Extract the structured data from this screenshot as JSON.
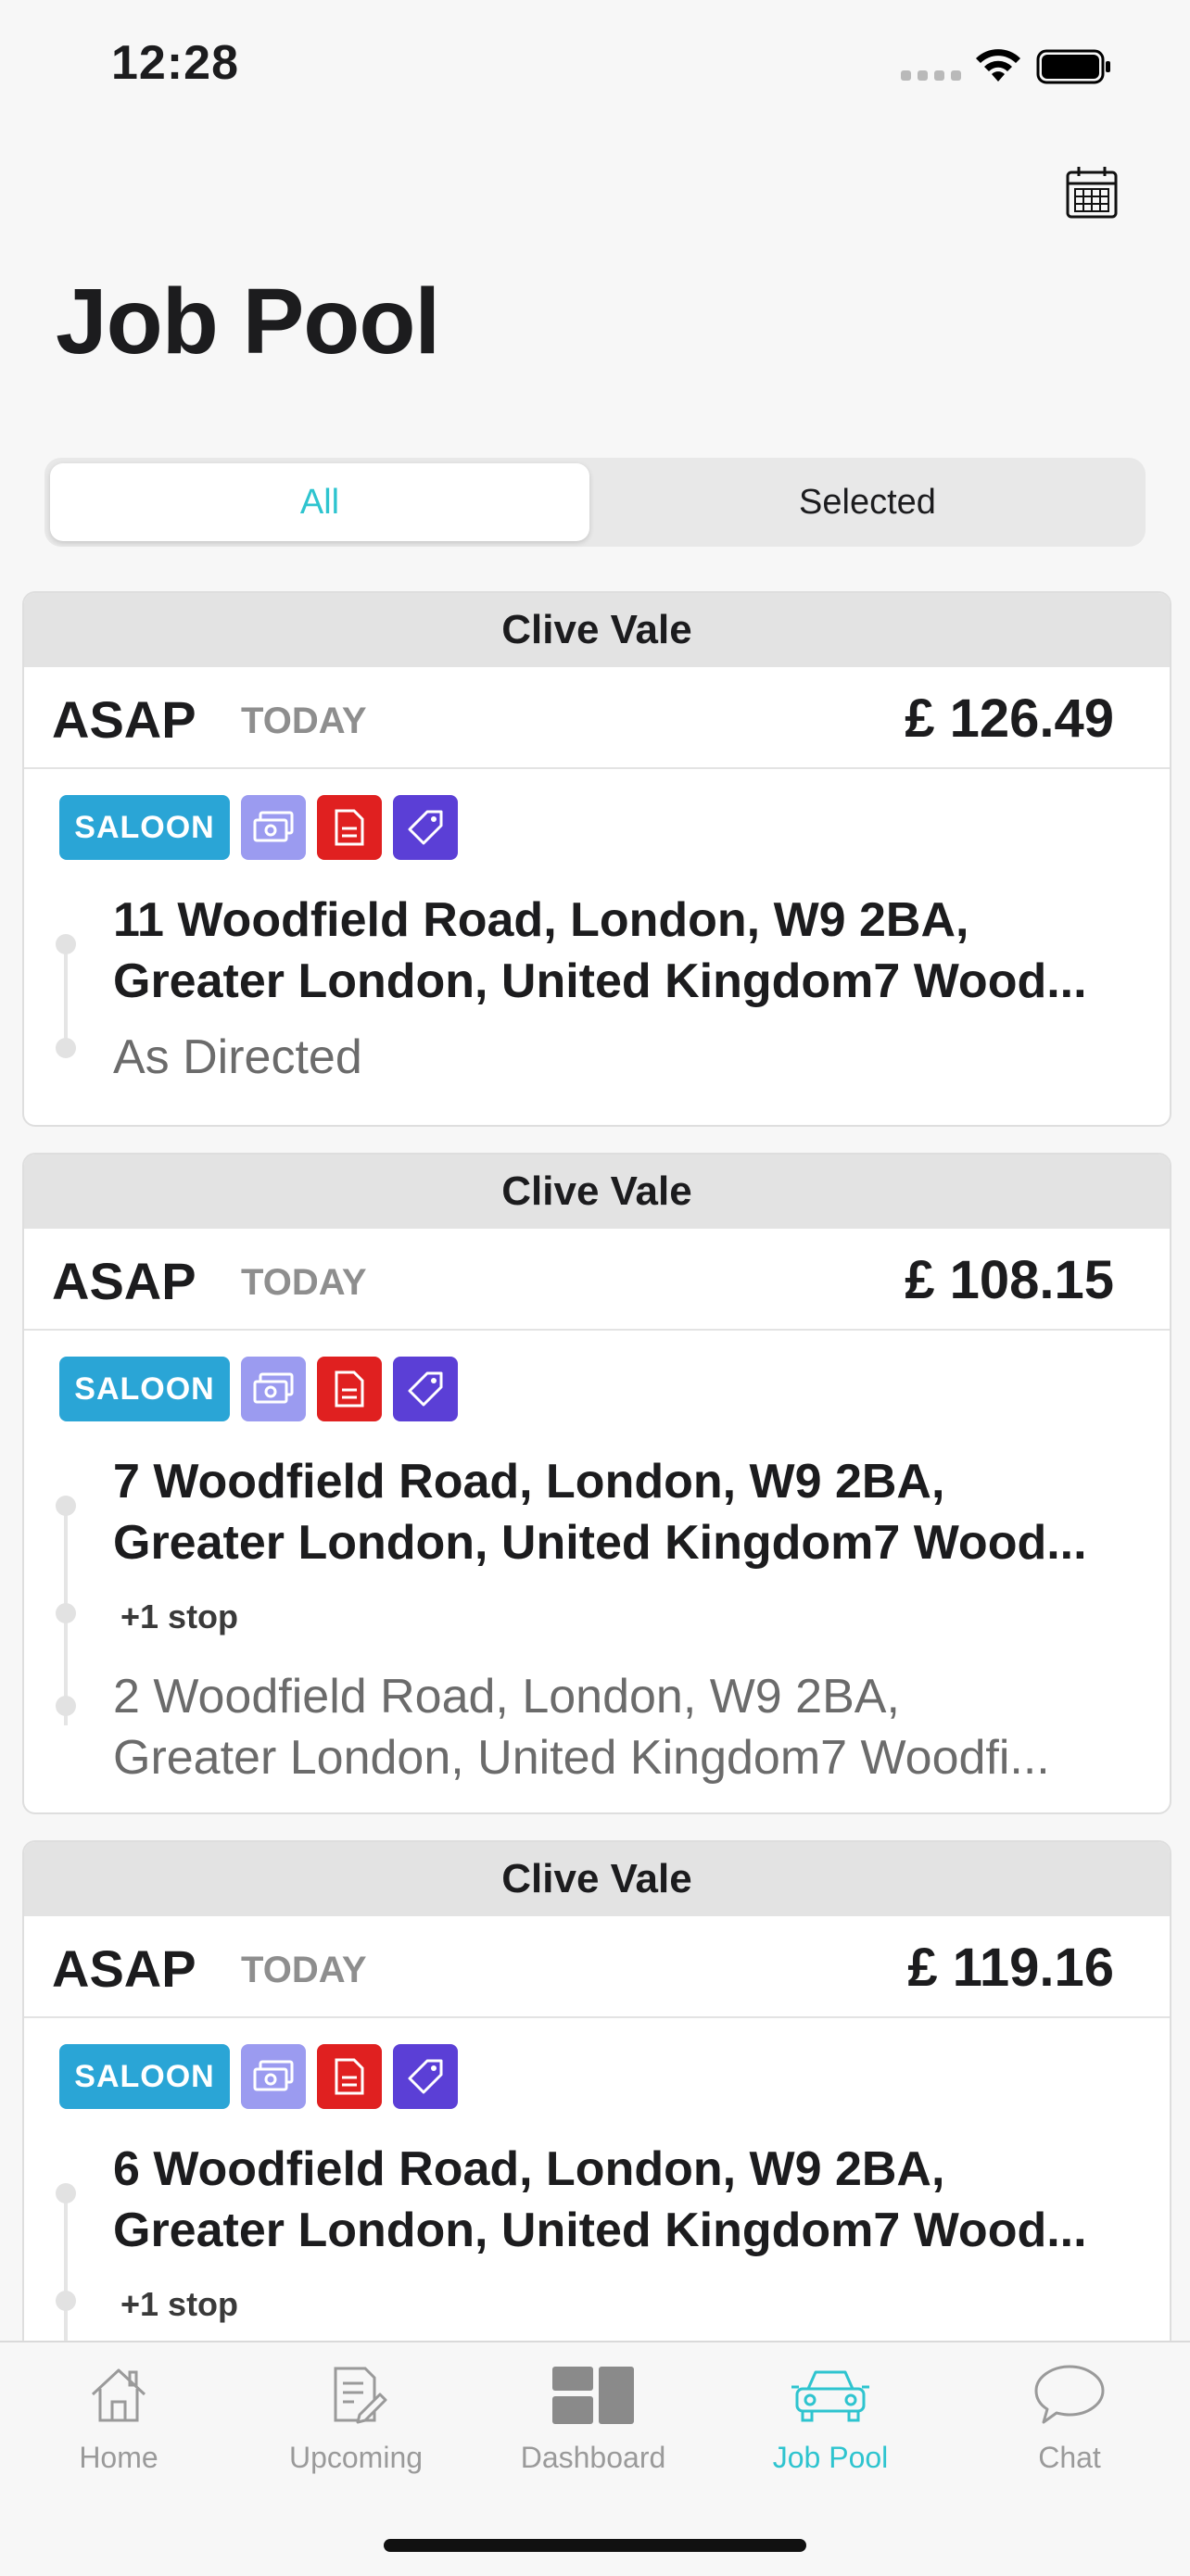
{
  "status": {
    "time": "12:28"
  },
  "header": {
    "title": "Job Pool",
    "calendar_icon": "calendar-icon"
  },
  "segments": {
    "all": "All",
    "selected": "Selected",
    "active": "all"
  },
  "cards": [
    {
      "customer": "Clive Vale",
      "timing": "ASAP",
      "day": "TODAY",
      "price": "£ 126.49",
      "vehicle": "SALOON",
      "pickup_line1": "11 Woodfield Road, London, W9 2BA,",
      "pickup_line2": "Greater London, United Kingdom7 Wood...",
      "dropoff": "As Directed"
    },
    {
      "customer": "Clive Vale",
      "timing": "ASAP",
      "day": "TODAY",
      "price": "£ 108.15",
      "vehicle": "SALOON",
      "pickup_line1": "7 Woodfield Road, London, W9 2BA,",
      "pickup_line2": "Greater London, United Kingdom7 Wood...",
      "stops": "+1 stop",
      "dropoff_line1": "2 Woodfield Road, London, W9 2BA,",
      "dropoff_line2": "Greater London, United Kingdom7 Woodfi..."
    },
    {
      "customer": "Clive Vale",
      "timing": "ASAP",
      "day": "TODAY",
      "price": "£ 119.16",
      "vehicle": "SALOON",
      "pickup_line1": "6 Woodfield Road, London, W9 2BA,",
      "pickup_line2": "Greater London, United Kingdom7 Wood...",
      "stops": "+1 stop"
    }
  ],
  "tabbar": {
    "home": "Home",
    "upcoming": "Upcoming",
    "dashboard": "Dashboard",
    "jobpool": "Job Pool",
    "chat": "Chat",
    "active": "jobpool"
  },
  "colors": {
    "accent": "#2ec4cf",
    "saloon": "#2aa5d6",
    "money_tag": "#9b9bf0",
    "doc_tag": "#e02020",
    "promo_tag": "#5b3fd6"
  }
}
